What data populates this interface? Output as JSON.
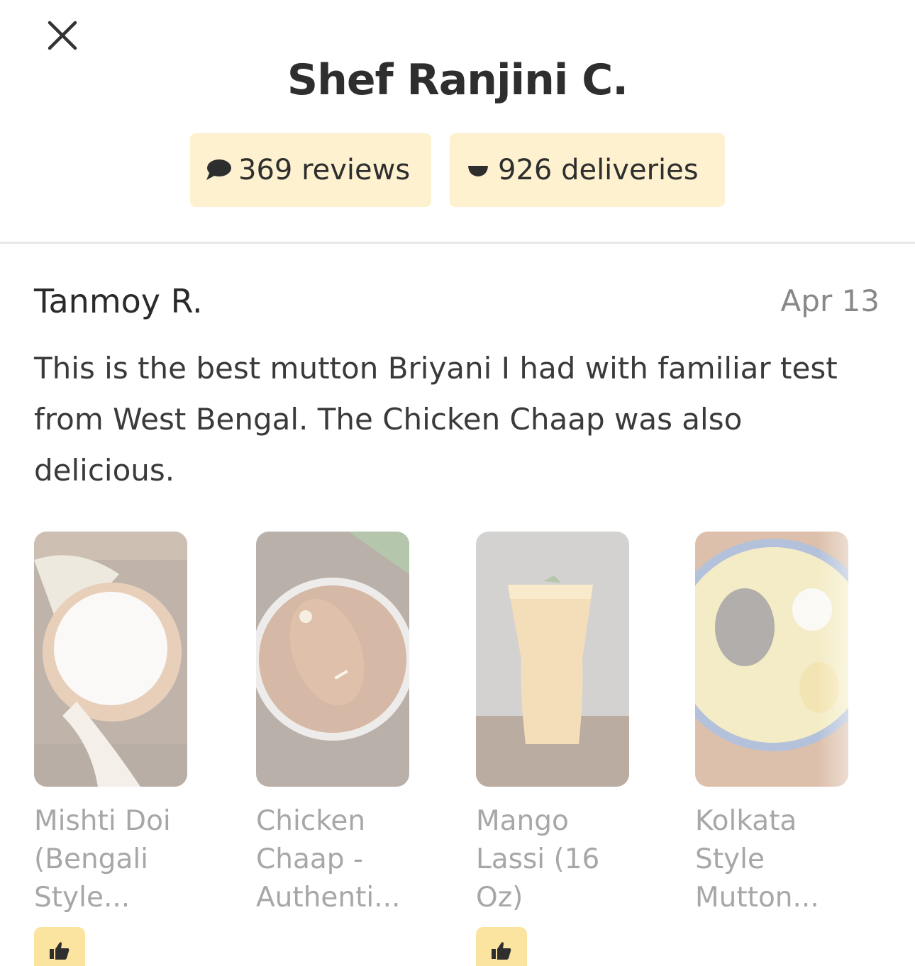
{
  "header": {
    "title": "Shef Ranjini C.",
    "close_icon": "close-icon"
  },
  "stats": {
    "reviews_label": "369 reviews",
    "deliveries_label": "926 deliveries",
    "chip_color": "#fdf1cf"
  },
  "review": {
    "author": "Tanmoy R.",
    "date": "Apr 13",
    "text": "This is the best mutton Briyani I had with familiar test from West Bengal. The Chicken Chaap was also delicious."
  },
  "dishes": [
    {
      "name": "Mishti Doi (Bengali Style...",
      "liked": true
    },
    {
      "name": "Chicken Chaap - Authenti...",
      "liked": false
    },
    {
      "name": "Mango Lassi (16 Oz)",
      "liked": true
    },
    {
      "name": "Kolkata Style Mutton...",
      "liked": false
    }
  ],
  "colors": {
    "like_badge": "#fbe3a0",
    "muted_text": "#a7a7a7"
  }
}
